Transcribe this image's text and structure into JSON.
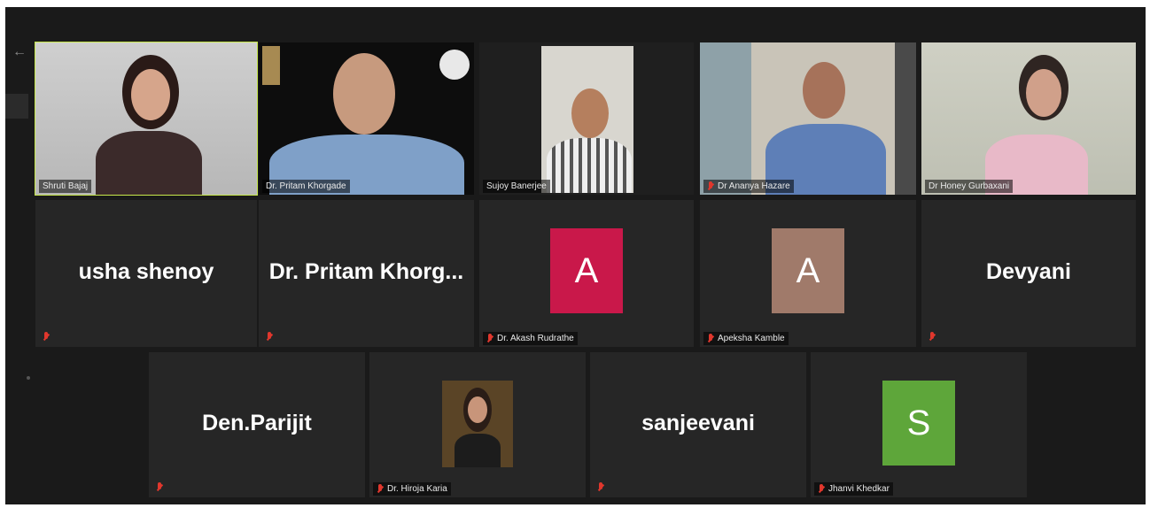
{
  "meeting": {
    "row1": [
      {
        "name": "Shruti Bajaj",
        "muted": false,
        "active": true
      },
      {
        "name": "Dr. Pritam Khorgade",
        "muted": false
      },
      {
        "name": "Sujoy Banerjee",
        "muted": false
      },
      {
        "name": "Dr Ananya Hazare",
        "muted": true
      },
      {
        "name": "Dr Honey Gurbaxani",
        "muted": false
      }
    ],
    "row2": [
      {
        "display": "usha shenoy",
        "muted": true
      },
      {
        "display": "Dr.  Pritam  Khorg...",
        "muted": true
      },
      {
        "avatar_letter": "A",
        "avatar_color": "#c9184a",
        "name": "Dr. Akash Rudrathe",
        "muted": true
      },
      {
        "avatar_letter": "A",
        "avatar_color": "#a07a6a",
        "name": "Apeksha Kamble",
        "muted": true
      },
      {
        "display": "Devyani",
        "muted": true
      }
    ],
    "row3": [
      {
        "display": "Den.Parijit",
        "muted": true
      },
      {
        "name": "Dr. Hiroja Karia",
        "muted": true
      },
      {
        "display": "sanjeevani",
        "muted": true
      },
      {
        "avatar_letter": "S",
        "avatar_color": "#5ea63a",
        "name": "Jhanvi Khedkar",
        "muted": true
      }
    ]
  },
  "colors": {
    "active_speaker_border": "#c7e84b",
    "muted_icon": "#e0372d",
    "tile_bg": "#262626"
  }
}
